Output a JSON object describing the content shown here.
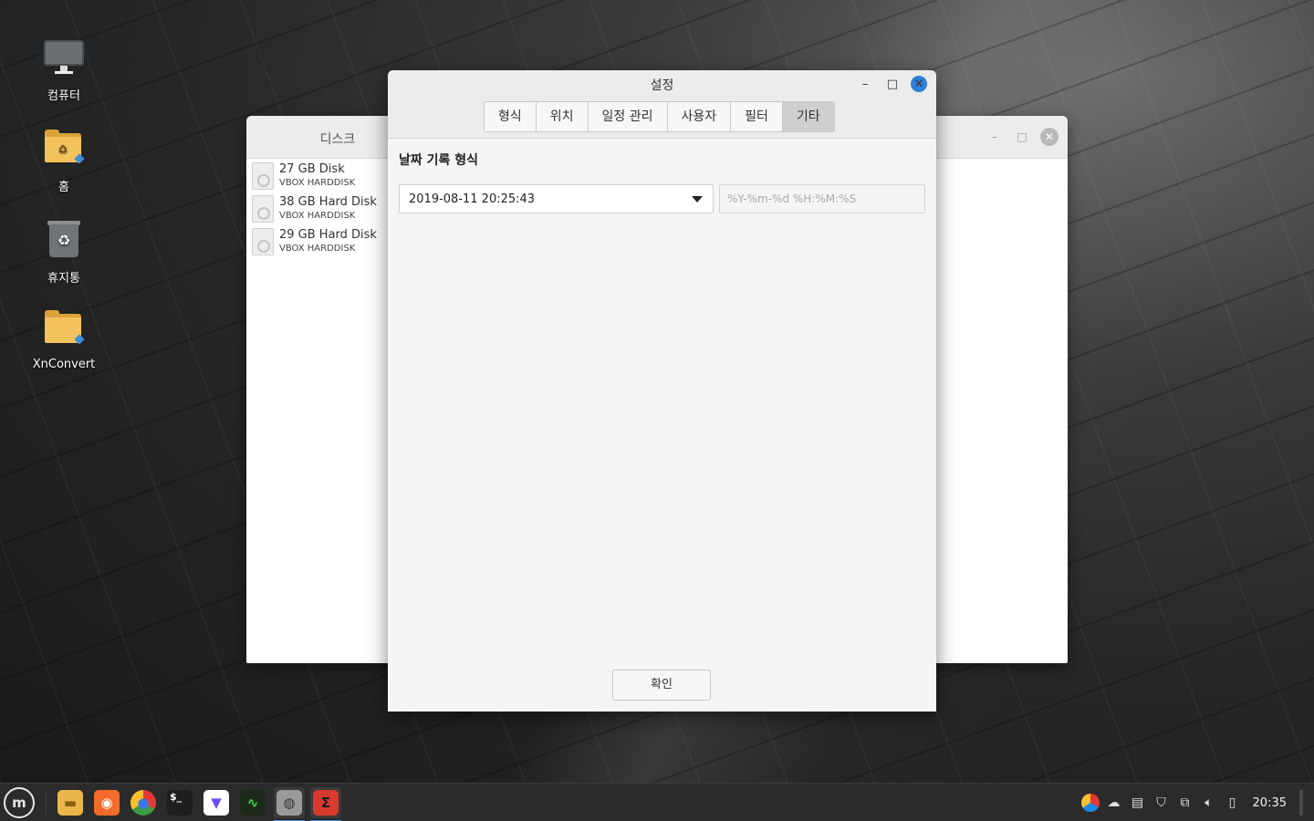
{
  "desktop": {
    "icons": [
      {
        "label": "컴퓨터",
        "icon": "computer-icon"
      },
      {
        "label": "홈",
        "icon": "home-folder-icon"
      },
      {
        "label": "휴지통",
        "icon": "trash-icon"
      },
      {
        "label": "XnConvert",
        "icon": "folder-icon"
      }
    ]
  },
  "disk_window": {
    "title": "디스크",
    "disks": [
      {
        "name": "27 GB Disk",
        "model": "VBOX HARDDISK"
      },
      {
        "name": "38 GB Hard Disk",
        "model": "VBOX HARDDISK"
      },
      {
        "name": "29 GB Hard Disk",
        "model": "VBOX HARDDISK"
      }
    ],
    "buttons": {
      "minimize": "–",
      "maximize": "□",
      "close": "✕"
    }
  },
  "settings_dialog": {
    "title": "설정",
    "buttons": {
      "minimize": "–",
      "maximize": "□",
      "close": "✕"
    },
    "tabs": [
      "형식",
      "위치",
      "일정 관리",
      "사용자",
      "필터",
      "기타"
    ],
    "active_tab": "기타",
    "section_title": "날짜 기록 형식",
    "date_format_selected": "2019-08-11 20:25:43",
    "format_placeholder": "%Y-%m-%d %H:%M:%S",
    "ok_label": "확인"
  },
  "taskbar": {
    "menu_label": "m",
    "launchers": [
      {
        "name": "files-launcher",
        "glyph": "▬",
        "color": "#e8b64a"
      },
      {
        "name": "firefox-launcher",
        "glyph": "◉",
        "color": "#f26b2a"
      },
      {
        "name": "chrome-launcher",
        "glyph": "●",
        "color": "#3b9d47"
      },
      {
        "name": "terminal-launcher",
        "glyph": "$_",
        "color": "#1e1e1e"
      },
      {
        "name": "protonvpn-launcher",
        "glyph": "▼",
        "color": "#ffffff"
      },
      {
        "name": "system-monitor-launcher",
        "glyph": "∿",
        "color": "#1c2a1c"
      },
      {
        "name": "disks-launcher",
        "glyph": "◍",
        "color": "#9a9a9a"
      },
      {
        "name": "timeshift-launcher",
        "glyph": "Σ",
        "color": "#d93a2f"
      }
    ],
    "clock": "20:35"
  },
  "colors": {
    "accent_blue": "#2f7fd8",
    "folder_yellow": "#f2c25c",
    "taskbar_bg": "#2b2b2b"
  }
}
